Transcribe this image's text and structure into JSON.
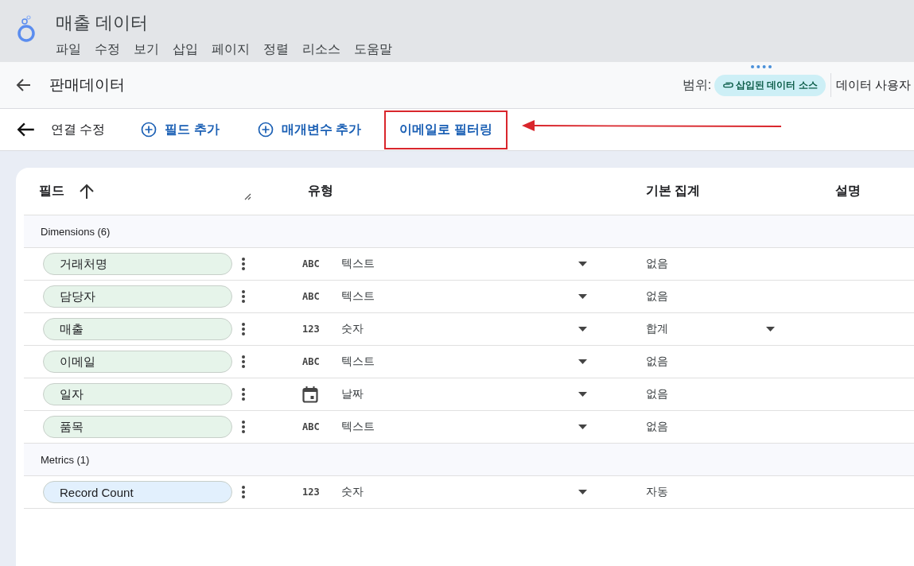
{
  "app": {
    "title": "매출 데이터",
    "menu": [
      "파일",
      "수정",
      "보기",
      "삽입",
      "페이지",
      "정렬",
      "리소스",
      "도움말"
    ]
  },
  "source_bar": {
    "title": "판매데이터",
    "scope_label": "범위:",
    "scope_chip": "삽입된 데이터 소스",
    "right_text": "데이터 사용자"
  },
  "toolbar": {
    "back_label": "연결 수정",
    "actions": [
      {
        "label": "필드 추가",
        "kind": "add",
        "highlighted": false
      },
      {
        "label": "매개변수 추가",
        "kind": "add",
        "highlighted": false
      },
      {
        "label": "이메일로 필터링",
        "kind": "plain",
        "highlighted": true
      }
    ]
  },
  "table": {
    "columns": [
      "필드",
      "유형",
      "기본 집계",
      "설명"
    ],
    "groups": [
      {
        "label": "Dimensions (6)",
        "kind": "dimension",
        "rows": [
          {
            "field": "거래처명",
            "kind": "text",
            "type_badge": "ABC",
            "type": "텍스트",
            "aggregation": "없음",
            "aggregation_editable": false
          },
          {
            "field": "담당자",
            "kind": "text",
            "type_badge": "ABC",
            "type": "텍스트",
            "aggregation": "없음",
            "aggregation_editable": false
          },
          {
            "field": "매출",
            "kind": "number",
            "type_badge": "123",
            "type": "숫자",
            "aggregation": "합계",
            "aggregation_editable": true
          },
          {
            "field": "이메일",
            "kind": "text",
            "type_badge": "ABC",
            "type": "텍스트",
            "aggregation": "없음",
            "aggregation_editable": false
          },
          {
            "field": "일자",
            "kind": "date",
            "type": "날짜",
            "aggregation": "없음",
            "aggregation_editable": false
          },
          {
            "field": "품목",
            "kind": "text",
            "type_badge": "ABC",
            "type": "텍스트",
            "aggregation": "없음",
            "aggregation_editable": false
          }
        ]
      },
      {
        "label": "Metrics (1)",
        "kind": "metric",
        "rows": [
          {
            "field": "Record Count",
            "kind": "number",
            "type_badge": "123",
            "type": "숫자",
            "aggregation": "자동",
            "aggregation_editable": false
          }
        ]
      }
    ]
  }
}
